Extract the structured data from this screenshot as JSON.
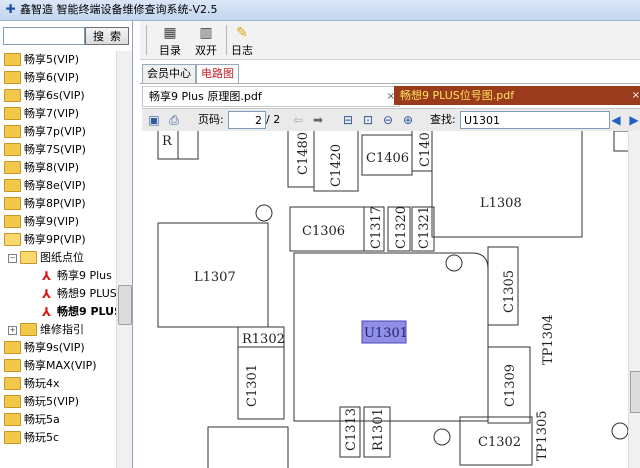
{
  "window": {
    "title": "鑫智造 智能终端设备维修查询系统-V2.5"
  },
  "sidebar": {
    "search_value": "",
    "search_button": "搜索",
    "items": [
      {
        "label": "畅享5(VIP)",
        "type": "folder"
      },
      {
        "label": "畅享6(VIP)",
        "type": "folder"
      },
      {
        "label": "畅享6s(VIP)",
        "type": "folder"
      },
      {
        "label": "畅享7(VIP)",
        "type": "folder"
      },
      {
        "label": "畅享7p(VIP)",
        "type": "folder"
      },
      {
        "label": "畅享7S(VIP)",
        "type": "folder"
      },
      {
        "label": "畅享8(VIP)",
        "type": "folder"
      },
      {
        "label": "畅享8e(VIP)",
        "type": "folder"
      },
      {
        "label": "畅享8P(VIP)",
        "type": "folder"
      },
      {
        "label": "畅享9(VIP)",
        "type": "folder"
      },
      {
        "label": "畅享9P(VIP)",
        "type": "folder-open"
      },
      {
        "label": "图纸点位",
        "type": "folder-open"
      },
      {
        "label": "畅享9 Plus",
        "type": "pdf"
      },
      {
        "label": "畅想9 PLUS",
        "type": "pdf"
      },
      {
        "label": "畅想9 PLUS",
        "type": "pdf-bold"
      },
      {
        "label": "维修指引",
        "type": "folder"
      },
      {
        "label": "畅享9s(VIP)",
        "type": "folder"
      },
      {
        "label": "畅享MAX(VIP)",
        "type": "folder"
      },
      {
        "label": "畅玩4x",
        "type": "folder"
      },
      {
        "label": "畅玩5(VIP)",
        "type": "folder"
      },
      {
        "label": "畅玩5a",
        "type": "folder"
      },
      {
        "label": "畅玩5c",
        "type": "folder"
      }
    ]
  },
  "toolbar": {
    "catalog": "目录",
    "dual": "双开",
    "log": "日志"
  },
  "tabs": {
    "member": "会员中心",
    "circuit": "电路图"
  },
  "doc_tabs": {
    "tab1": "畅享9 Plus 原理图.pdf",
    "tab2": "畅想9 PLUS位号图.pdf",
    "close": "×"
  },
  "pdf_toolbar": {
    "page_label": "页码:",
    "page_value": "2",
    "page_total": "/ 2",
    "search_label": "查找:",
    "search_value": "U1301"
  },
  "schematic": {
    "labels": [
      "R",
      "C1480",
      "C1420",
      "C1406",
      "C140",
      "L1308",
      "C1306",
      "C1317",
      "C1320",
      "C1321",
      "L1307",
      "C1305",
      "TP1304",
      "U1301",
      "R1302",
      "C1301",
      "C1309",
      "C1313",
      "R1301",
      "C1302",
      "TP1305"
    ],
    "highlight": "U1301",
    "highlight_color": "#8f8fe8"
  }
}
